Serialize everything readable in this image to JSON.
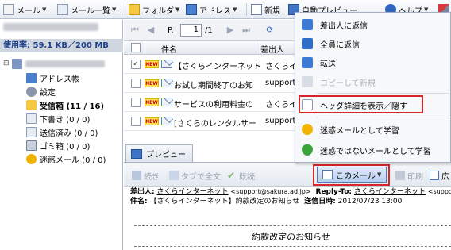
{
  "toolbar": {
    "mail": "メール",
    "mail_list": "メール一覧",
    "folder": "フォルダ",
    "address": "アドレス",
    "new": "新規",
    "auto_preview": "自動プレビュー",
    "help": "ヘルプ"
  },
  "sidebar": {
    "usage": "使用率: 59.1 KB／200 MB",
    "items": [
      {
        "label": "アドレス帳"
      },
      {
        "label": "設定"
      },
      {
        "label": "受信箱 (11 / 16)"
      },
      {
        "label": "下書き (0 / 0)"
      },
      {
        "label": "送信済み (0 / 0)"
      },
      {
        "label": "ゴミ箱 (0 / 0)"
      },
      {
        "label": "迷惑メール (0 / 0)"
      }
    ]
  },
  "pager": {
    "prefix": "P.",
    "page": "1",
    "total": "/1"
  },
  "list": {
    "col_subject": "件名",
    "col_from": "差出人",
    "new_badge": "NEW",
    "rows": [
      {
        "subject": "【さくらインターネット】約",
        "from": "さくらイン",
        "checked": true
      },
      {
        "subject": "お試し期間終了のお知",
        "from": "support@",
        "checked": false
      },
      {
        "subject": "サービスの利用料金の",
        "from": "さくらイン",
        "checked": false
      },
      {
        "subject": "[さくらのレンタルサー",
        "from": "support@",
        "checked": false
      }
    ]
  },
  "menu": {
    "items": [
      {
        "label": "差出人に返信",
        "icon": "reply-icon"
      },
      {
        "label": "全員に返信",
        "icon": "reply-all-icon"
      },
      {
        "label": "転送",
        "icon": "forward-icon"
      },
      {
        "label": "コピーして新規",
        "icon": "copy-new-icon",
        "disabled": true
      },
      {
        "label": "ヘッダ詳細を表示／隠す",
        "icon": "header-detail-icon"
      },
      {
        "label": "迷惑メールとして学習",
        "icon": "spam-icon"
      },
      {
        "label": "迷惑ではないメールとして学習",
        "icon": "not-spam-icon"
      }
    ]
  },
  "preview": {
    "tab": "プレビュー",
    "continue": "続き",
    "open_tab": "タブで全文",
    "approve": "既読",
    "this_mail": "このメール",
    "print": "印刷",
    "spread": "広"
  },
  "header": {
    "from_label": "差出人:",
    "from_value": "さくらインターネット",
    "from_addr": "<support@sakura.ad.jp>",
    "replyto_label": "Reply-To:",
    "replyto_value": "さくらインターネット",
    "replyto_addr": "<support@s",
    "subject_label": "件名:",
    "subject_value": "【さくらインターネット】約款改定のお知らせ",
    "date_label": "送信日時:",
    "date_value": "2012/07/23 13:00"
  },
  "body": {
    "title": "約款改定のお知らせ"
  }
}
